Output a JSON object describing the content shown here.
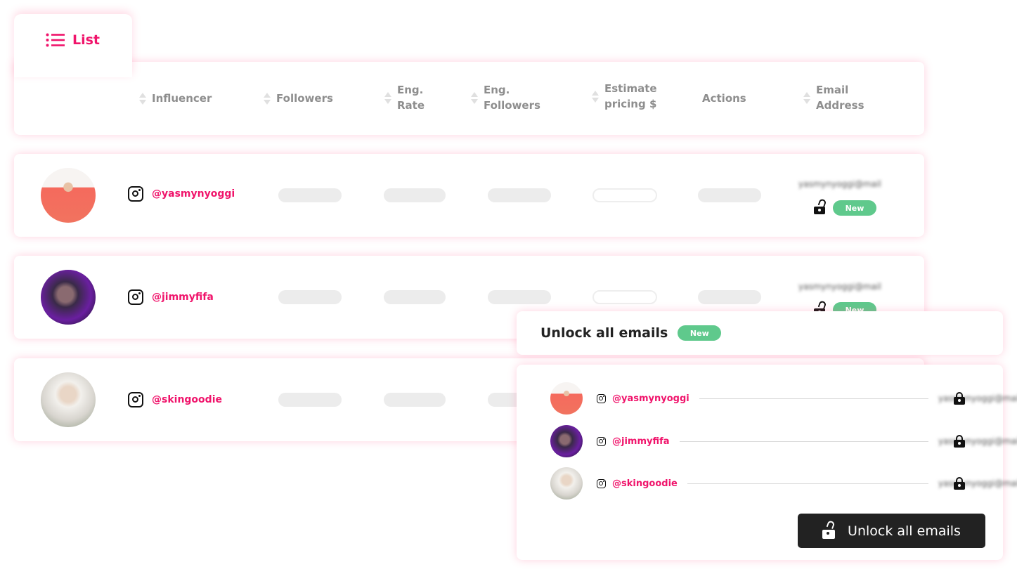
{
  "tab": {
    "label": "List",
    "icon": "list-icon"
  },
  "columns": [
    "Influencer",
    "Followers",
    "Eng.\nRate",
    "Eng.\nFollowers",
    "Estimate\npricing $",
    "Actions",
    "Email\nAddress"
  ],
  "rows": [
    {
      "handle": "@yasmynyoggi",
      "email": "yasmynyoggi@mail",
      "badge": "New",
      "locked": false
    },
    {
      "handle": "@jimmyfifa",
      "email": "yasmynyoggi@mail",
      "badge": "New",
      "locked": false
    },
    {
      "handle": "@skingoodie",
      "email": "",
      "badge": "",
      "locked": false
    }
  ],
  "popup": {
    "title": "Unlock all emails",
    "badge": "New",
    "items": [
      {
        "handle": "@yasmynyoggi",
        "email": "yasmynyoggi@mail"
      },
      {
        "handle": "@jimmyfifa",
        "email": "yasmynyoggi@mail"
      },
      {
        "handle": "@skingoodie",
        "email": "yasmynyoggi@mail"
      }
    ],
    "button": "Unlock all emails"
  },
  "colors": {
    "accent": "#f0146b",
    "badge": "#5fc98c",
    "button": "#222222"
  }
}
